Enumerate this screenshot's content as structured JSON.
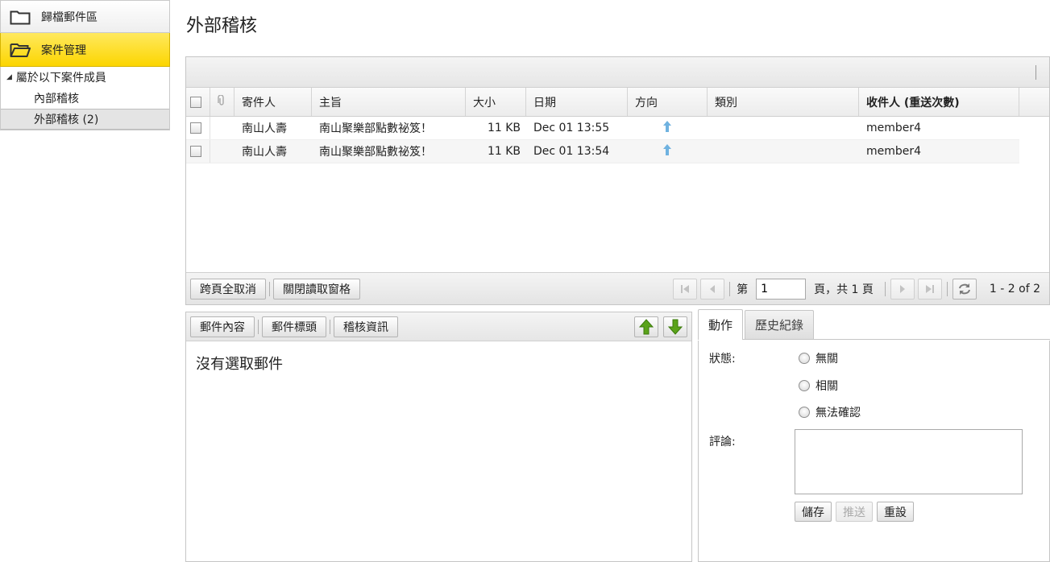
{
  "sidebar": {
    "items": [
      {
        "label": "歸檔郵件區",
        "icon": "folder-icon"
      },
      {
        "label": "案件管理",
        "icon": "folder-open-icon"
      }
    ],
    "tree": {
      "root": "屬於以下案件成員",
      "children": [
        "內部稽核",
        "外部稽核 (2)"
      ]
    }
  },
  "page": {
    "title": "外部稽核"
  },
  "grid": {
    "columns": [
      "寄件人",
      "主旨",
      "大小",
      "日期",
      "方向",
      "類別",
      "收件人 (重送次數)"
    ],
    "rows": [
      {
        "from": "南山人壽",
        "subject": "南山聚樂部點數祕笈！",
        "size": "11 KB",
        "date": "Dec 01 13:55",
        "direction_icon": "arrow-up-icon",
        "category": "",
        "recipient": "member4"
      },
      {
        "from": "南山人壽",
        "subject": "南山聚樂部點數祕笈！",
        "size": "11 KB",
        "date": "Dec 01 13:54",
        "direction_icon": "arrow-up-icon",
        "category": "",
        "recipient": "member4"
      }
    ],
    "pager": {
      "deselect_all": "跨頁全取消",
      "close_reading_pane": "關閉讀取窗格",
      "page_prefix": "第",
      "page_value": "1",
      "page_suffix": "頁，共 1 頁",
      "summary": "1 - 2 of 2"
    }
  },
  "preview": {
    "tabs": [
      "郵件內容",
      "郵件標頭",
      "稽核資訊"
    ],
    "empty_message": "沒有選取郵件"
  },
  "action": {
    "tabs": [
      "動作",
      "歷史紀錄"
    ],
    "status_label": "狀態:",
    "status_options": [
      "無關",
      "相關",
      "無法確認"
    ],
    "comment_label": "評論:",
    "buttons": {
      "save": "儲存",
      "forward": "推送",
      "reset": "重設"
    }
  },
  "colors": {
    "active_nav": "#fcd500",
    "arrow_blue": "#6fb2e0",
    "arrow_green": "#5aa31a"
  }
}
